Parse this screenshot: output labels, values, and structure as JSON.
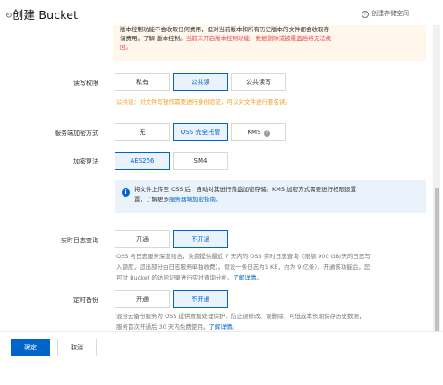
{
  "header": {
    "title": "创建 Bucket",
    "title_icon": "back-icon",
    "help_link": "创建存储空间",
    "help_icon": "question-circle-icon"
  },
  "versioning_notice": {
    "line1": "版本控制功能不会收取任何费用，但对当前版本和所有历史版本的文件都会收取存",
    "line2_prefix": "储费用。了解 版本控制。",
    "line2_red": "当前未开启版本控制功能，数据删除或被覆盖后将无法找",
    "line3_red": "回。"
  },
  "acl": {
    "label": "读写权限",
    "options": [
      "私有",
      "公共读",
      "公共读写"
    ],
    "selected": "公共读",
    "hint": "公共读：对文件写操作需要进行身份验证，可以对文件进行匿名读。"
  },
  "encryption": {
    "label": "服务端加密方式",
    "options": [
      "无",
      "OSS 完全托管",
      "KMS"
    ],
    "selected": "OSS 完全托管"
  },
  "algorithm": {
    "label": "加密算法",
    "options": [
      "AES256",
      "SM4"
    ],
    "selected": "AES256"
  },
  "encryption_info": {
    "icon": "info-icon",
    "line1": "将文件上传至 OSS 后，自动对其进行落盘加密存储。KMS 加密方式需要进行权限设置",
    "line2_prefix": "置，了解更多",
    "line2_link": "服务器端加密指南。"
  },
  "realtime_log": {
    "label": "实时日志查询",
    "options": [
      "开通",
      "不开通"
    ],
    "selected": "不开通",
    "hint_line1": "OSS 与日志服务深度结合，免费提供最近 7 天内的 OSS 实时日志查询（限额 900 GB/天的日志写",
    "hint_line2": "入额度，超出部分由日志服务单独收费）。假设一条日志为1 KB，约为 9 亿条）。开通该功能后，您",
    "hint_line3_prefix": "可对 Bucket 的访问记录进行实时查询分析。",
    "hint_line3_link": "了解详情。"
  },
  "scheduled_backup": {
    "label": "定时备份",
    "options": [
      "开通",
      "不开通"
    ],
    "selected": "不开通",
    "hint_line1": "混合云备份服务为 OSS 提供数据处理保护，防止误修改、误删除，可低成本长期保存历史数据，",
    "hint_line2_prefix": "服务首次开通后 30 天内免费使用。",
    "hint_line2_link": "了解详情。"
  },
  "footer": {
    "confirm": "确定",
    "cancel": "取消"
  },
  "colors": {
    "primary": "#0064c8",
    "warning": "#f0a020",
    "danger": "#e5484d"
  }
}
